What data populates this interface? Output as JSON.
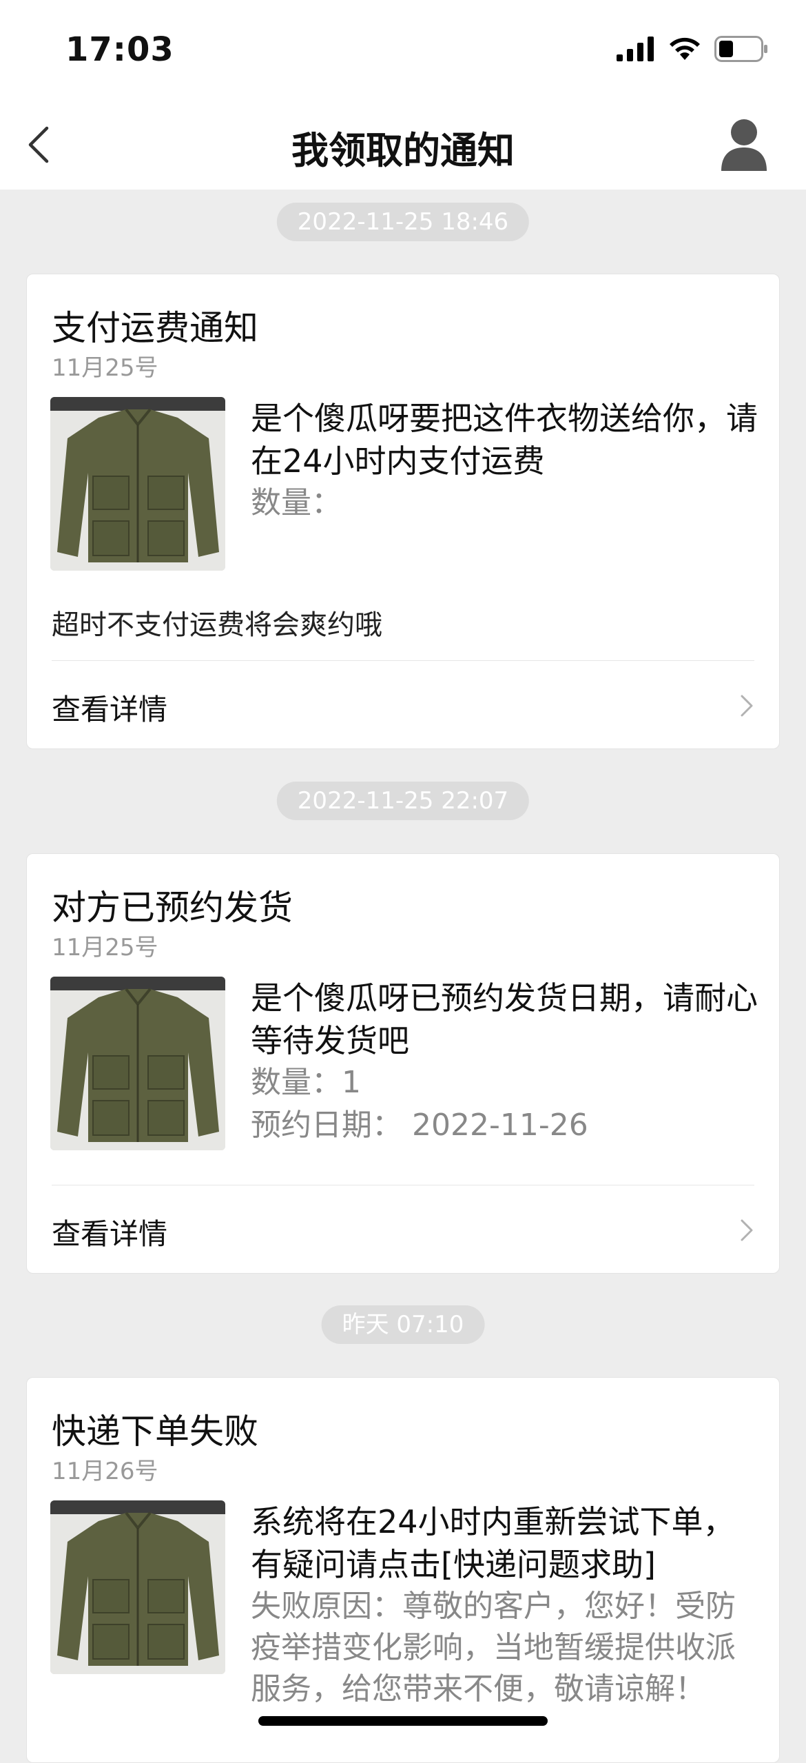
{
  "status_bar": {
    "time": "17:03"
  },
  "header": {
    "title": "我领取的通知"
  },
  "notifications": [
    {
      "timestamp": "2022-11-25 18:46",
      "title": "支付运费通知",
      "date": "11月25号",
      "description": "是个傻瓜呀要把这件衣物送给你，请在24小时内支付运费",
      "quantity_label": "数量：",
      "note": "超时不支付运费将会爽约哦",
      "details_label": "查看详情"
    },
    {
      "timestamp": "2022-11-25 22:07",
      "title": "对方已预约发货",
      "date": "11月25号",
      "description": "是个傻瓜呀已预约发货日期，请耐心等待发货吧",
      "quantity_label": "数量：1",
      "appointment": "预约日期：  2022-11-26",
      "details_label": "查看详情"
    },
    {
      "timestamp": "昨天 07:10",
      "title": "快递下单失败",
      "date": "11月26号",
      "description": "系统将在24小时内重新尝试下单，有疑问请点击[快递问题求助]",
      "failure_reason": "失败原因：尊敬的客户，您好！受防疫举措变化影响，当地暂缓提供收派服务，给您带来不便，敬请谅解！"
    }
  ],
  "colors": {
    "background": "#ededed",
    "card": "#ffffff",
    "pill": "#dcdcdc",
    "muted_text": "#999999"
  }
}
